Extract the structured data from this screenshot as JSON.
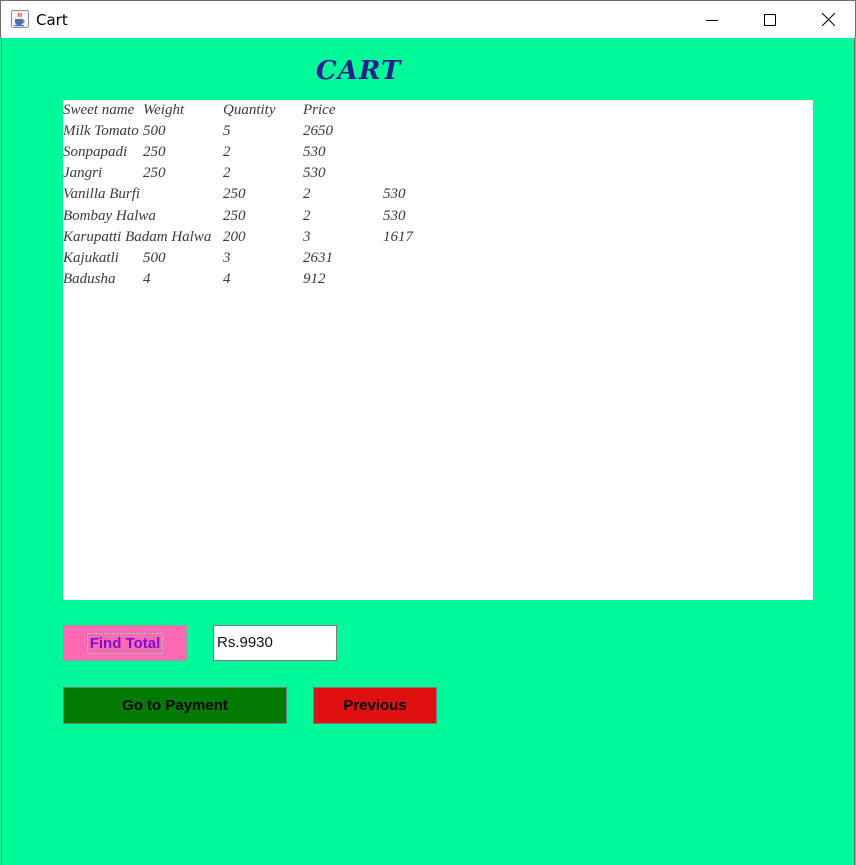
{
  "window": {
    "title": "Cart",
    "icon": "java-cup-icon"
  },
  "window_controls": [
    "minimize-icon",
    "maximize-icon",
    "close-icon"
  ],
  "heading": "CART",
  "cart": {
    "header": [
      "Sweet name",
      "Weight",
      "Quantity",
      "Price"
    ],
    "rows": [
      [
        "Milk Tomato",
        "500",
        "5",
        "2650"
      ],
      [
        "Sonpapadi",
        "250",
        "2",
        "530"
      ],
      [
        "Jangri",
        "250",
        "2",
        "530"
      ],
      [
        "Vanilla Burfi",
        "",
        "250",
        "2",
        "530"
      ],
      [
        "Bombay Halwa",
        "",
        "250",
        "2",
        "530"
      ],
      [
        "Karupatti Badam Halwa",
        "200",
        "3",
        "1617"
      ],
      [
        "Kajukatli",
        "500",
        "3",
        "2631"
      ],
      [
        "Badusha",
        "4",
        "4",
        "912"
      ]
    ]
  },
  "buttons": {
    "find_total": "Find Total",
    "go_to_payment": "Go to Payment",
    "previous": "Previous"
  },
  "total_field": {
    "value": "Rs.9930"
  },
  "colors": {
    "background": "#00fa9a",
    "find_total_bg": "#ff69b4",
    "find_total_text": "#7a0ed8",
    "payment_bg": "#007a00",
    "previous_bg": "#e01010",
    "heading_text": "#2a1f8f"
  }
}
